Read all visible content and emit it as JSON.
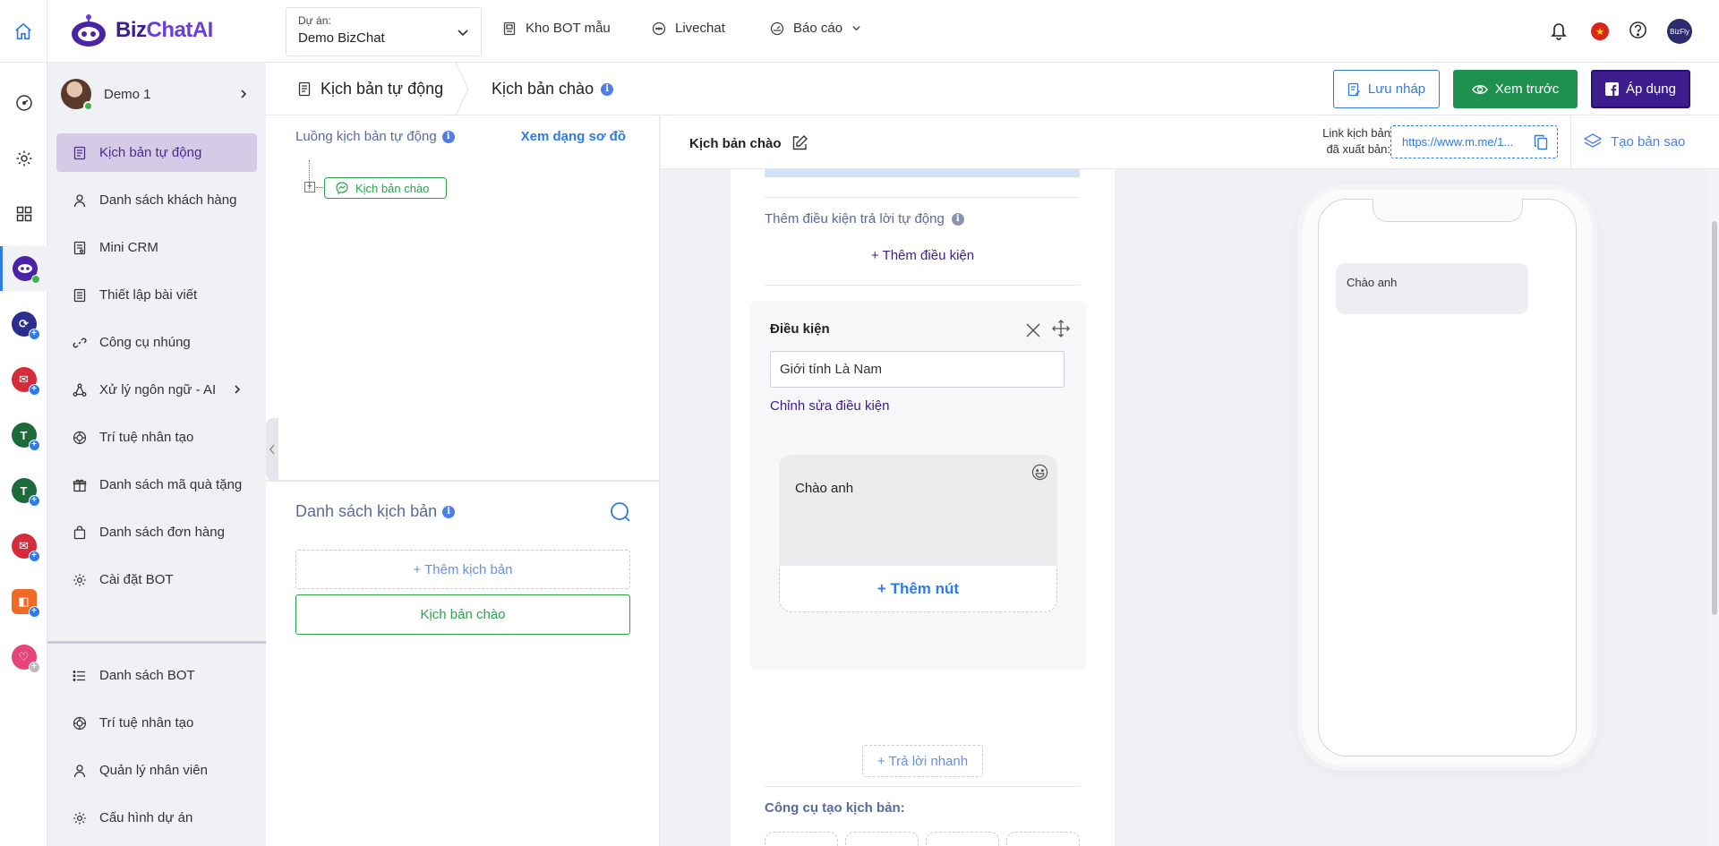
{
  "app": {
    "logo_text_a": "Biz",
    "logo_text_b": "ChatAI"
  },
  "header": {
    "project_label": "Dự án:",
    "project_value": "Demo BizChat",
    "nav_bot_templates": "Kho BOT mẫu",
    "nav_livechat": "Livechat",
    "nav_reports": "Báo cáo"
  },
  "sidebar": {
    "user_name": "Demo 1",
    "items": [
      {
        "label": "Kịch bản tự động"
      },
      {
        "label": "Danh sách khách hàng"
      },
      {
        "label": "Mini CRM"
      },
      {
        "label": "Thiết lập bài viết"
      },
      {
        "label": "Công cụ nhúng"
      },
      {
        "label": "Xử lý ngôn ngữ - AI"
      },
      {
        "label": "Trí tuệ nhân tạo"
      },
      {
        "label": "Danh sách mã quà tặng"
      },
      {
        "label": "Danh sách đơn hàng"
      },
      {
        "label": "Cài đặt BOT"
      }
    ],
    "bottom_items": [
      {
        "label": "Danh sách BOT"
      },
      {
        "label": "Trí tuệ nhân tạo"
      },
      {
        "label": "Quản lý nhân viên"
      },
      {
        "label": "Cấu hình dự án"
      }
    ]
  },
  "breadcrumb": {
    "section": "Kịch bản tự động",
    "current": "Kịch bản chào"
  },
  "actions": {
    "save_draft": "Lưu nháp",
    "preview": "Xem trước",
    "apply": "Áp dụng"
  },
  "flow": {
    "title": "Luồng kịch bản tự động",
    "view_diagram": "Xem dạng sơ đồ",
    "node_label": "Kịch bản chào",
    "list_title": "Danh sách kịch bản",
    "add_script": "+ Thêm kịch bản",
    "scripts": [
      {
        "name": "Kịch bản chào"
      }
    ]
  },
  "script": {
    "name": "Kịch bản chào",
    "link_label_line1": "Link kịch bản",
    "link_label_line2": "đã xuất bản:",
    "link_url": "https://www.m.me/1...",
    "copy_script": "Tạo bản sao"
  },
  "editor": {
    "auto_reply_condition_title": "Thêm điều kiện trả lời tự động",
    "add_condition": "+ Thêm điều kiện",
    "condition_label": "Điều kiện",
    "condition_value": "Giới tính  Là  Nam",
    "edit_condition": "Chỉnh sửa điều kiện",
    "message_text": "Chào anh",
    "add_button": "+ Thêm nút",
    "quick_reply": "+ Trả lời nhanh",
    "tools_title": "Công cụ tạo kịch bản:"
  },
  "preview": {
    "bubble_text": "Chào anh"
  },
  "colors": {
    "brand": "#3d1d8e",
    "accent_blue": "#2f7ae5",
    "success_green": "#1e9150",
    "active_item_bg": "#d5cbe6"
  }
}
